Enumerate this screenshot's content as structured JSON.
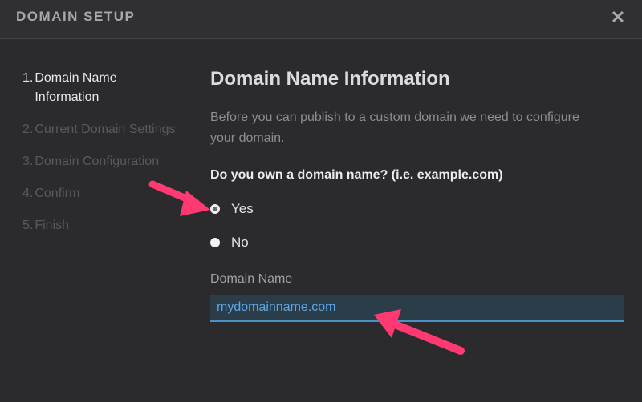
{
  "dialog": {
    "title": "DOMAIN SETUP",
    "close_symbol": "✕"
  },
  "steps": [
    {
      "num": "1.",
      "label": "Domain Name Information",
      "active": true
    },
    {
      "num": "2.",
      "label": "Current Domain Settings",
      "active": false
    },
    {
      "num": "3.",
      "label": "Domain Configuration",
      "active": false
    },
    {
      "num": "4.",
      "label": "Confirm",
      "active": false
    },
    {
      "num": "5.",
      "label": "Finish",
      "active": false
    }
  ],
  "content": {
    "title": "Domain Name Information",
    "intro": "Before you can publish to a custom domain we need to configure your domain.",
    "question": "Do you own a domain name? (i.e. example.com)",
    "options": [
      {
        "label": "Yes",
        "selected": true
      },
      {
        "label": "No",
        "selected": false
      }
    ],
    "domain_field": {
      "label": "Domain Name",
      "value": "mydomainname.com"
    }
  },
  "colors": {
    "background": "#2b2b2d",
    "header": "#303032",
    "accent": "#4a8fc6",
    "annotation_arrow": "#ff3a72"
  },
  "icons": {
    "close": "close-icon",
    "annotation": "arrow-annotation-icon"
  }
}
